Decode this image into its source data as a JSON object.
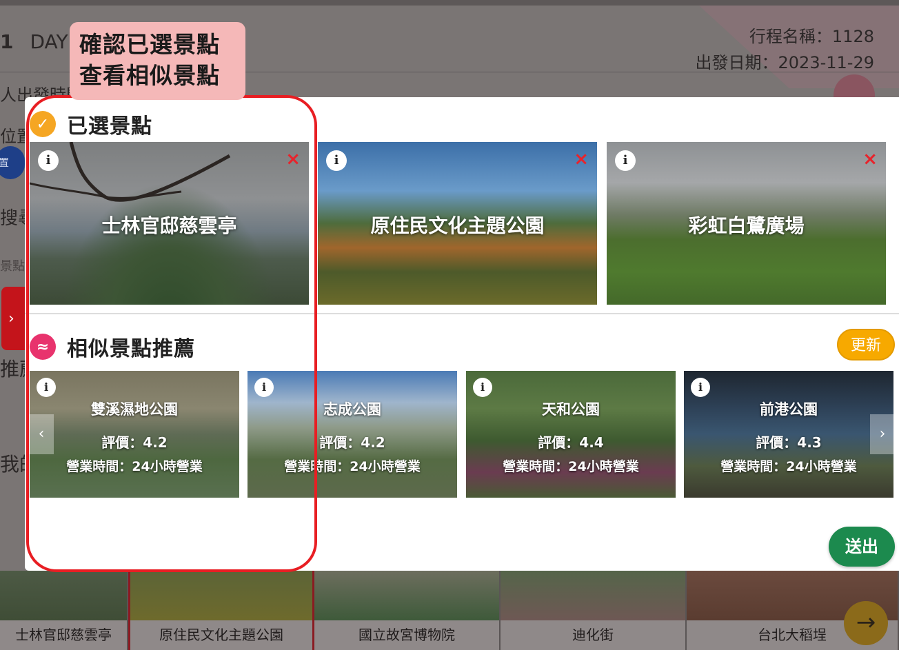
{
  "background": {
    "day_label": "1",
    "day_word": "DAY",
    "trip_name": "行程名稱：1128",
    "depart_date": "出發日期：2023-11-29",
    "side_labels": [
      "人出發時間",
      "位置",
      "搜尋",
      "景點",
      "推薦",
      "我的"
    ],
    "pill_text": "置",
    "red_tab_icon": "chevron-right",
    "bottom_cards": [
      {
        "label": "士林官邸慈雲亭"
      },
      {
        "label": "原住民文化主題公園"
      },
      {
        "label": "國立故宮博物院"
      },
      {
        "label": "迪化街"
      },
      {
        "label": "台北大稻埕"
      }
    ],
    "arrow_btn": "→"
  },
  "modal": {
    "selected_title": "已選景點",
    "selected_icon": "✓",
    "selected": [
      {
        "name": "士林官邸慈雲亭",
        "info": "i",
        "close": "×"
      },
      {
        "name": "原住民文化主題公園",
        "info": "i",
        "close": "×"
      },
      {
        "name": "彩虹白鷺廣場",
        "info": "i",
        "close": "×"
      }
    ],
    "similar_title": "相似景點推薦",
    "similar_icon": "≈",
    "refresh_label": "更新",
    "recommendations": [
      {
        "name": "雙溪濕地公園",
        "rating": "評價：4.2",
        "hours": "營業時間：24小時營業",
        "info": "i"
      },
      {
        "name": "志成公園",
        "rating": "評價：4.2",
        "hours": "營業時間：24小時營業",
        "info": "i"
      },
      {
        "name": "天和公園",
        "rating": "評價：4.4",
        "hours": "營業時間：24小時營業",
        "info": "i"
      },
      {
        "name": "前港公園",
        "rating": "評價：4.3",
        "hours": "營業時間：24小時營業",
        "info": "i"
      }
    ],
    "prev_arrow": "‹",
    "next_arrow": "›",
    "submit_label": "送出"
  },
  "tutorial": {
    "line1": "確認已選景點",
    "line2": "查看相似景點"
  },
  "colors": {
    "selected_icon": "#f5a623",
    "similar_icon": "#e8336d",
    "refresh": "#f7a900",
    "submit": "#1c8a4e",
    "highlight": "#e81e23",
    "callout": "#f5b8b8"
  }
}
